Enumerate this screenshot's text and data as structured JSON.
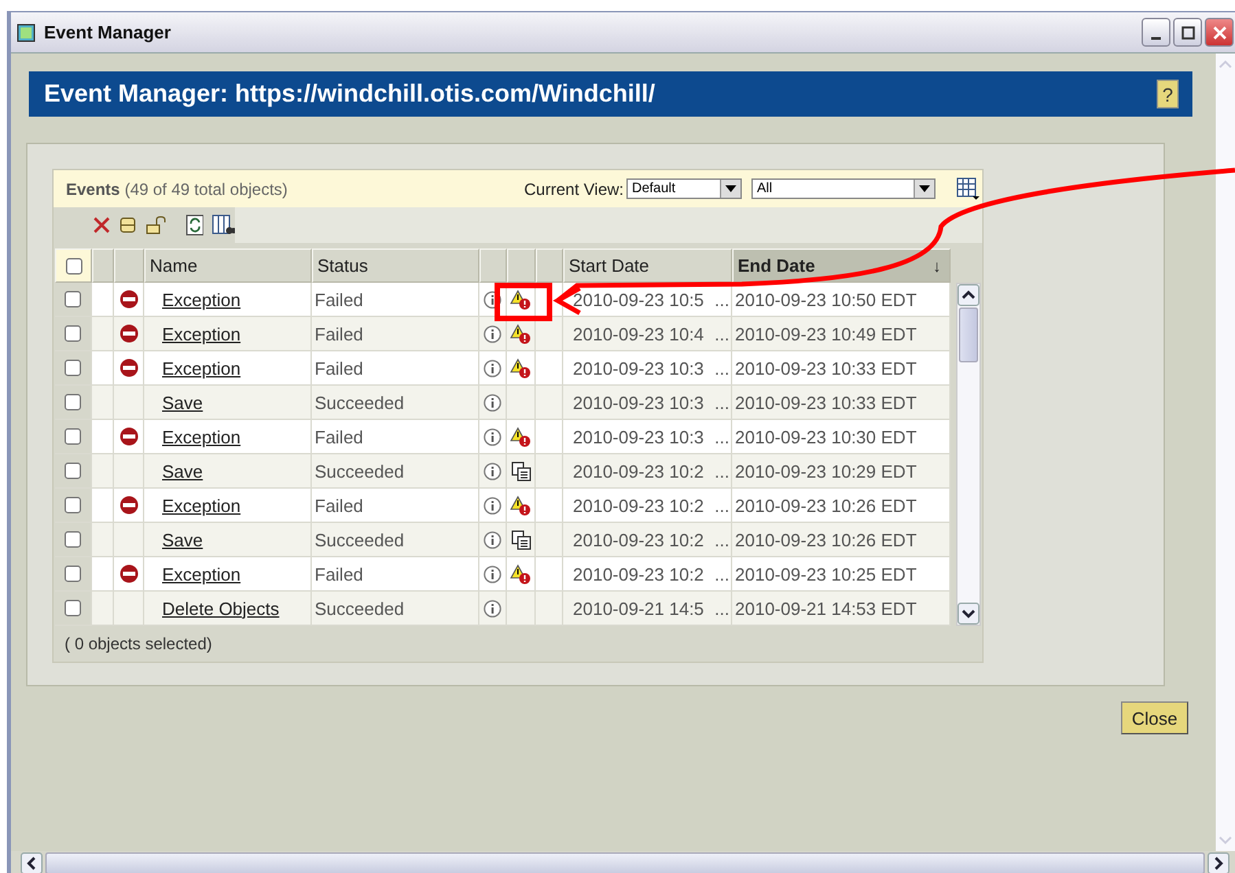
{
  "window": {
    "title": "Event Manager"
  },
  "header": {
    "title": "Event Manager: https://windchill.otis.com/Windchill/",
    "help": "?"
  },
  "events_panel": {
    "title": "**Events** (49 of 49 total objects)",
    "view_label": "Current View:",
    "view_value": "Default",
    "filter_value": "All"
  },
  "table": {
    "select_all": {
      "checked": false
    },
    "columns": [
      {
        "label": "Name",
        "sorted": false
      },
      {
        "label": "Status",
        "sorted": false
      },
      {
        "label": "Start Date",
        "sorted": false
      },
      {
        "label": "End Date",
        "sorted": true
      }
    ],
    "sort_indicator": "↓",
    "rows": [
      {
        "checked": false,
        "error": true,
        "warning": true,
        "document": false,
        "name": "Exception",
        "status": "Failed",
        "start_date": "2010-09-23 10:5",
        "start_more": "...",
        "end_date": "2010-09-23 10:50 EDT"
      },
      {
        "checked": false,
        "error": true,
        "warning": true,
        "document": false,
        "name": "Exception",
        "status": "Failed",
        "start_date": "2010-09-23 10:4",
        "start_more": "...",
        "end_date": "2010-09-23 10:49 EDT"
      },
      {
        "checked": false,
        "error": true,
        "warning": true,
        "document": false,
        "name": "Exception",
        "status": "Failed",
        "start_date": "2010-09-23 10:3",
        "start_more": "...",
        "end_date": "2010-09-23 10:33 EDT"
      },
      {
        "checked": false,
        "error": false,
        "warning": false,
        "document": false,
        "name": "Save",
        "status": "Succeeded",
        "start_date": "2010-09-23 10:3",
        "start_more": "...",
        "end_date": "2010-09-23 10:33 EDT"
      },
      {
        "checked": false,
        "error": true,
        "warning": true,
        "document": false,
        "name": "Exception",
        "status": "Failed",
        "start_date": "2010-09-23 10:3",
        "start_more": "...",
        "end_date": "2010-09-23 10:30 EDT"
      },
      {
        "checked": false,
        "error": false,
        "warning": false,
        "document": true,
        "name": "Save",
        "status": "Succeeded",
        "start_date": "2010-09-23 10:2",
        "start_more": "...",
        "end_date": "2010-09-23 10:29 EDT"
      },
      {
        "checked": false,
        "error": true,
        "warning": true,
        "document": false,
        "name": "Exception",
        "status": "Failed",
        "start_date": "2010-09-23 10:2",
        "start_more": "...",
        "end_date": "2010-09-23 10:26 EDT"
      },
      {
        "checked": false,
        "error": false,
        "warning": false,
        "document": true,
        "name": "Save",
        "status": "Succeeded",
        "start_date": "2010-09-23 10:2",
        "start_more": "...",
        "end_date": "2010-09-23 10:26 EDT"
      },
      {
        "checked": false,
        "error": true,
        "warning": true,
        "document": false,
        "name": "Exception",
        "status": "Failed",
        "start_date": "2010-09-23 10:2",
        "start_more": "...",
        "end_date": "2010-09-23 10:25 EDT"
      },
      {
        "checked": false,
        "error": false,
        "warning": false,
        "document": false,
        "name": "Delete Objects",
        "status": "Succeeded",
        "start_date": "2010-09-21 14:5",
        "start_more": "...",
        "end_date": "2010-09-21 14:53 EDT"
      }
    ],
    "footer": "( 0 objects selected)"
  },
  "buttons": {
    "close": "Close"
  }
}
